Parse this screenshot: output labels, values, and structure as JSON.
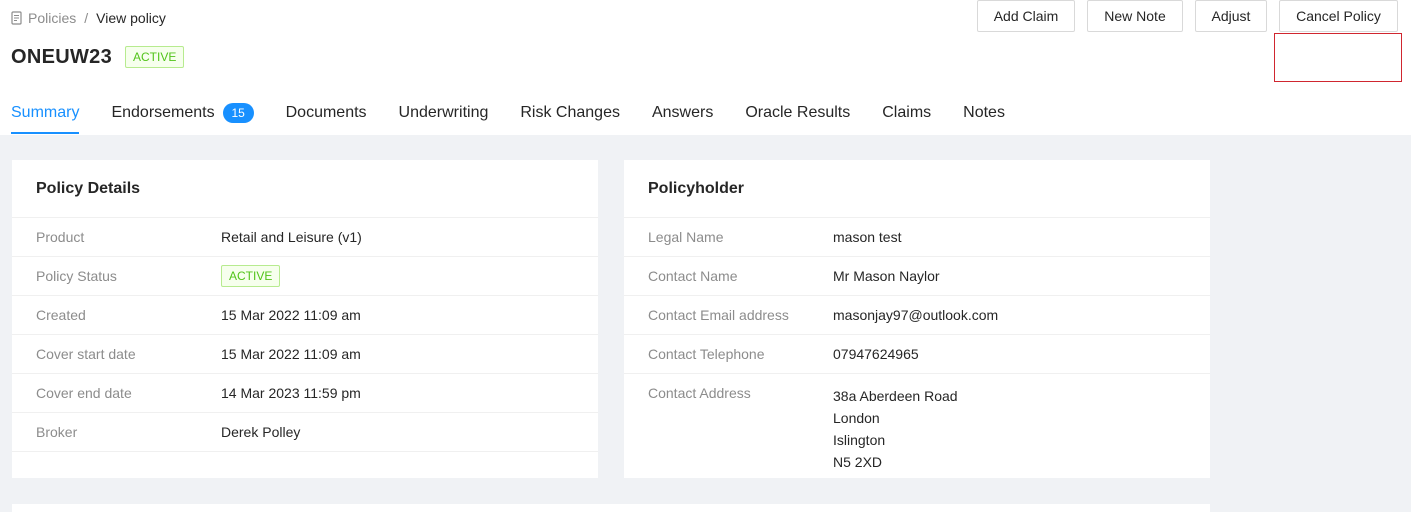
{
  "breadcrumb": {
    "parent": "Policies",
    "separator": "/",
    "current": "View policy"
  },
  "header": {
    "title": "ONEUW23",
    "status": "ACTIVE"
  },
  "actions": {
    "add_claim": "Add Claim",
    "new_note": "New Note",
    "adjust": "Adjust",
    "cancel_policy": "Cancel Policy"
  },
  "tabs": {
    "summary": "Summary",
    "endorsements": "Endorsements",
    "endorsements_count": "15",
    "documents": "Documents",
    "underwriting": "Underwriting",
    "risk_changes": "Risk Changes",
    "answers": "Answers",
    "oracle_results": "Oracle Results",
    "claims": "Claims",
    "notes": "Notes"
  },
  "policy_details": {
    "title": "Policy Details",
    "rows": [
      {
        "label": "Product",
        "value": "Retail and Leisure (v1)"
      },
      {
        "label": "Policy Status",
        "value": "ACTIVE"
      },
      {
        "label": "Created",
        "value": "15 Mar 2022 11:09 am"
      },
      {
        "label": "Cover start date",
        "value": "15 Mar 2022 11:09 am"
      },
      {
        "label": "Cover end date",
        "value": "14 Mar 2023 11:59 pm"
      },
      {
        "label": "Broker",
        "value": "Derek Polley"
      }
    ]
  },
  "policyholder": {
    "title": "Policyholder",
    "rows": [
      {
        "label": "Legal Name",
        "value": "mason test"
      },
      {
        "label": "Contact Name",
        "value": "Mr Mason Naylor"
      },
      {
        "label": "Contact Email address",
        "value": "masonjay97@outlook.com"
      },
      {
        "label": "Contact Telephone",
        "value": "07947624965"
      }
    ],
    "address_label": "Contact Address",
    "address_lines": [
      "38a Aberdeen Road",
      "London",
      "Islington",
      "N5 2XD"
    ]
  },
  "colors": {
    "primary": "#1890ff",
    "success": "#52c41a",
    "highlight": "#d0262f",
    "background": "#f0f2f5"
  }
}
